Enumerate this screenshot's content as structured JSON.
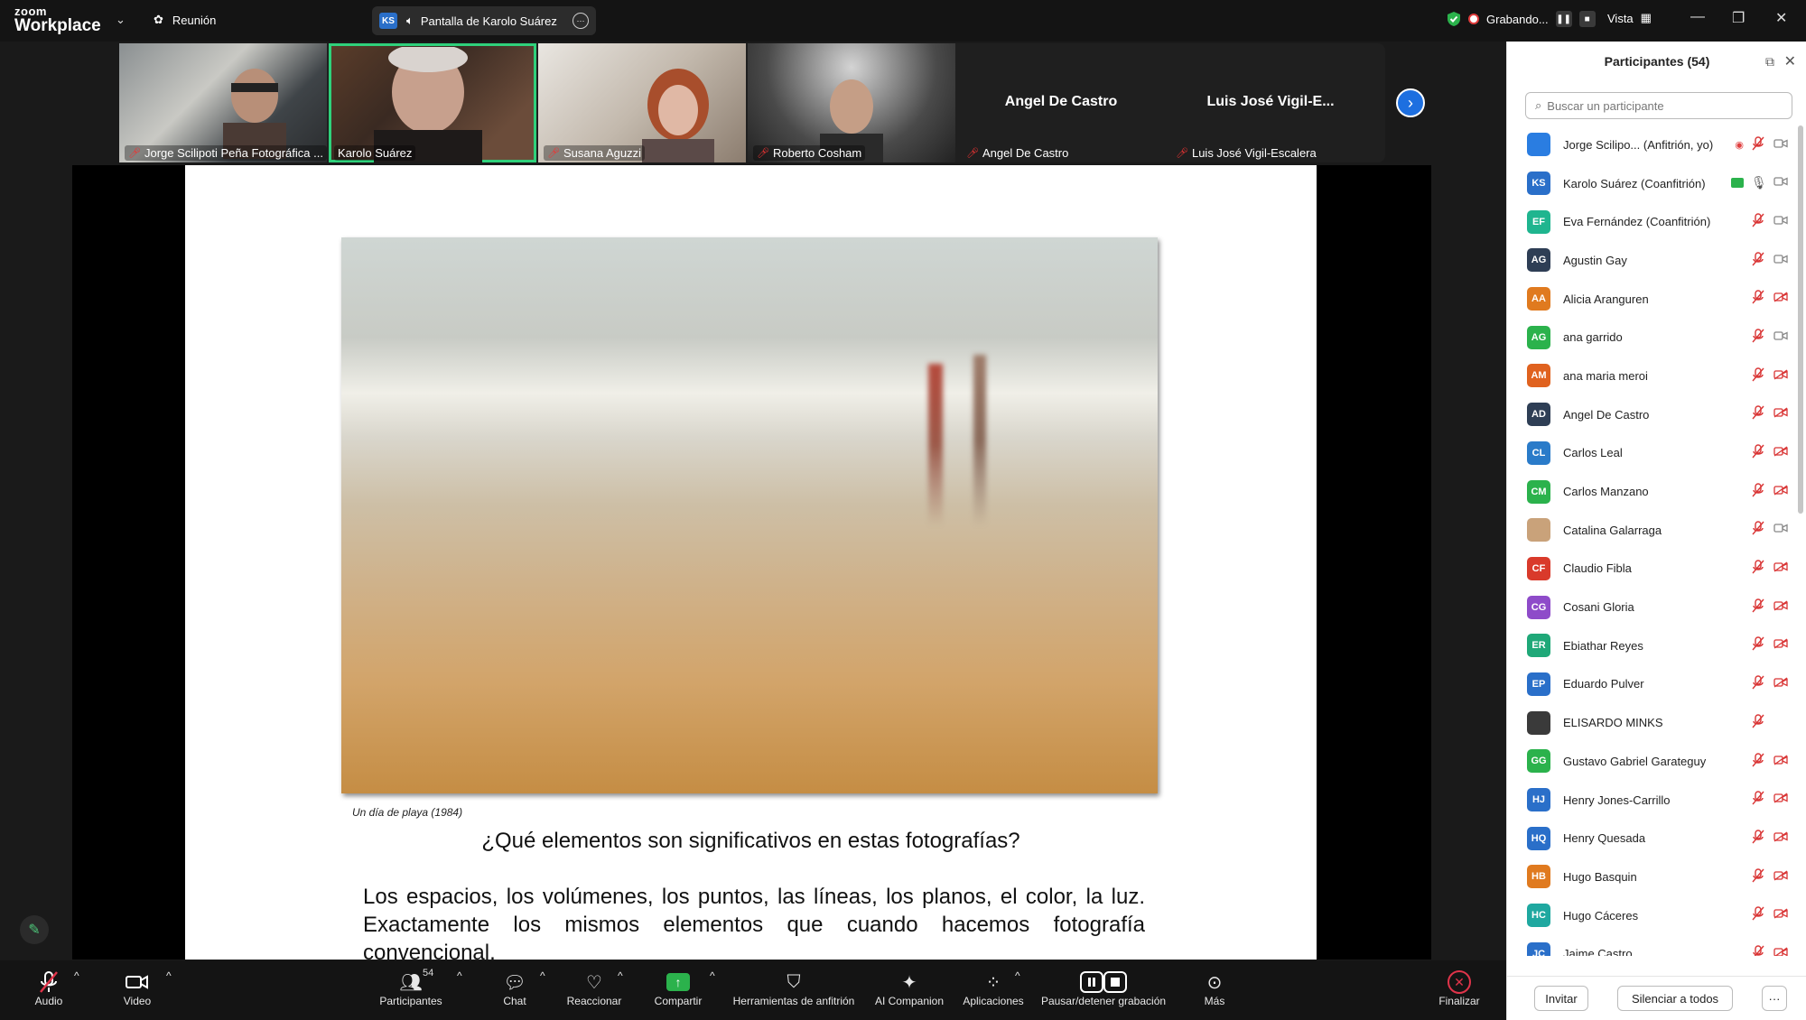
{
  "topbar": {
    "brand_small": "zoom",
    "brand_large": "Workplace",
    "meeting_label": "Reunión",
    "share_initials": "KS",
    "share_label": "Pantalla de Karolo Suárez",
    "recording_label": "Grabando...",
    "view_label": "Vista"
  },
  "video_tiles": [
    {
      "name": "Jorge Scilipoti Peña Fotográfica ..."
    },
    {
      "name": "Karolo Suárez"
    },
    {
      "name": "Susana Aguzzi"
    },
    {
      "name": "Roberto Cosham"
    },
    {
      "name": "Angel De Castro",
      "display": "Angel De Castro"
    },
    {
      "name": "Luis José Vigil-Escalera",
      "display": "Luis José Vigil-E..."
    }
  ],
  "slide": {
    "caption": "Un día de playa (1984)",
    "question": "¿Qué elementos son significativos en estas fotografías?",
    "body": "Los espacios, los volúmenes, los puntos, las líneas, los planos, el color, la luz. Exactamente los mismos elementos que cuando hacemos fotografía convencional."
  },
  "toolbar": {
    "audio": "Audio",
    "video": "Video",
    "participants": "Participantes",
    "participants_count": "54",
    "chat": "Chat",
    "react": "Reaccionar",
    "share": "Compartir",
    "host_tools": "Herramientas de anfitrión",
    "ai": "AI Companion",
    "apps": "Aplicaciones",
    "pause_rec": "Pausar/detener grabación",
    "more": "Más",
    "end": "Finalizar"
  },
  "panel": {
    "title": "Participantes (54)",
    "search_placeholder": "Buscar un participante",
    "invite": "Invitar",
    "mute_all": "Silenciar a todos",
    "more": "···",
    "participants": [
      {
        "initials": "",
        "name": "Jorge Scilipo... (Anfitrión, yo)",
        "color": "#2a7de1",
        "mic": "muted",
        "cam": "on",
        "rec": true
      },
      {
        "initials": "KS",
        "name": "Karolo Suárez (Coanfitrión)",
        "color": "#2a6fc9",
        "mic": "on",
        "cam": "on",
        "share": true
      },
      {
        "initials": "EF",
        "name": "Eva Fernández (Coanfitrión)",
        "color": "#1fb58f",
        "mic": "muted",
        "cam": "on"
      },
      {
        "initials": "AG",
        "name": "Agustin Gay",
        "color": "#2e3e55",
        "mic": "muted",
        "cam": "on"
      },
      {
        "initials": "AA",
        "name": "Alicia Aranguren",
        "color": "#e07a1f",
        "mic": "muted",
        "cam": "off"
      },
      {
        "initials": "AG",
        "name": "ana garrido",
        "color": "#2bb24c",
        "mic": "muted",
        "cam": "on"
      },
      {
        "initials": "AM",
        "name": "ana maria meroi",
        "color": "#e0621f",
        "mic": "muted",
        "cam": "off"
      },
      {
        "initials": "AD",
        "name": "Angel De Castro",
        "color": "#2e3e55",
        "mic": "muted",
        "cam": "off"
      },
      {
        "initials": "CL",
        "name": "Carlos Leal",
        "color": "#2a7bc9",
        "mic": "muted",
        "cam": "off"
      },
      {
        "initials": "CM",
        "name": "Carlos Manzano",
        "color": "#2bb24c",
        "mic": "muted",
        "cam": "off"
      },
      {
        "initials": "",
        "name": "Catalina Galarraga",
        "color": "#c9a27a",
        "mic": "muted",
        "cam": "on"
      },
      {
        "initials": "CF",
        "name": "Claudio Fibla",
        "color": "#d93a2b",
        "mic": "muted",
        "cam": "off"
      },
      {
        "initials": "CG",
        "name": "Cosani Gloria",
        "color": "#8e4bc9",
        "mic": "muted",
        "cam": "off"
      },
      {
        "initials": "ER",
        "name": "Ebiathar Reyes",
        "color": "#1fa878",
        "mic": "muted",
        "cam": "off"
      },
      {
        "initials": "EP",
        "name": "Eduardo Pulver",
        "color": "#2a6fc9",
        "mic": "muted",
        "cam": "off"
      },
      {
        "initials": "",
        "name": "ELISARDO MINKS",
        "color": "#3a3a3a",
        "mic": "muted",
        "cam": ""
      },
      {
        "initials": "GG",
        "name": "Gustavo Gabriel Garateguy",
        "color": "#2bb24c",
        "mic": "muted",
        "cam": "off"
      },
      {
        "initials": "HJ",
        "name": "Henry Jones-Carrillo",
        "color": "#2a6fc9",
        "mic": "muted",
        "cam": "off"
      },
      {
        "initials": "HQ",
        "name": "Henry Quesada",
        "color": "#2a6fc9",
        "mic": "muted",
        "cam": "off"
      },
      {
        "initials": "HB",
        "name": "Hugo Basquin",
        "color": "#e07a1f",
        "mic": "muted",
        "cam": "off"
      },
      {
        "initials": "HC",
        "name": "Hugo Cáceres",
        "color": "#1fa8a0",
        "mic": "muted",
        "cam": "off"
      },
      {
        "initials": "JC",
        "name": "Jaime Castro",
        "color": "#2a6fc9",
        "mic": "muted",
        "cam": "off"
      }
    ]
  }
}
